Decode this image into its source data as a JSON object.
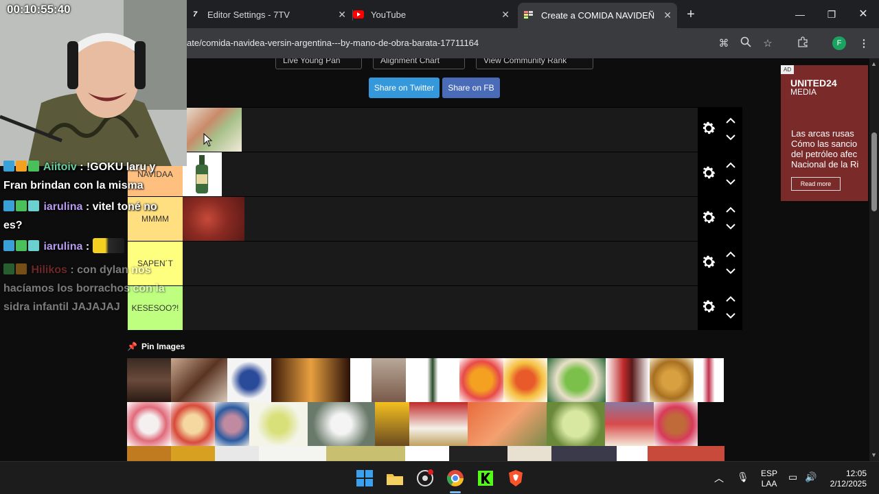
{
  "browser": {
    "tabs": [
      {
        "title": "Editor Settings - 7TV",
        "icon": "7tv-icon"
      },
      {
        "title": "YouTube",
        "icon": "youtube-icon"
      },
      {
        "title": "Create a COMIDA NAVIDEÑA ve",
        "icon": "tiermaker-icon"
      }
    ],
    "url": "ate/comida-navidea-versin-argentina---by-mano-de-obra-barata-17711164",
    "profile_initial": "F"
  },
  "page": {
    "top_buttons": [
      "Live Young Pan",
      "Alignment Chart",
      "View Community Rank"
    ],
    "share_twitter": "Share on Twitter",
    "share_fb": "Share on FB",
    "tiers": [
      {
        "label": "",
        "color": "#ff7f7f"
      },
      {
        "label": "NAVIDAA",
        "color": "#ffbf7f"
      },
      {
        "label": "MMMM",
        "color": "#ffdf7f"
      },
      {
        "label": "SAPEN´T",
        "color": "#ffff7f"
      },
      {
        "label": "KESESOO?!",
        "color": "#bfff7f"
      }
    ],
    "pin_images_label": "Pin Images"
  },
  "ad": {
    "tag": "AD",
    "brand_line1": "UNITED24",
    "brand_line2": "MEDIA",
    "text_lines": [
      "Las arcas rusas",
      "Cómo las sancio",
      "del petróleo afec",
      "Nacional de la Ri"
    ],
    "button": "Read more"
  },
  "stream": {
    "timer": "00:10:55:40",
    "chat": [
      {
        "user": "Aiitoiv",
        "text": ": !GOKU laru y Fran brindan con la misma"
      },
      {
        "user": "iarulina",
        "text": ": vitel toné no es?"
      },
      {
        "user": "iarulina",
        "text": ":"
      },
      {
        "user": "Hilikos",
        "text": ": con dylan nos hacíamos los borrachos con la sidra infantil JAJAJAJ"
      }
    ]
  },
  "taskbar": {
    "lang": "ESP",
    "lang_sub": "LAA",
    "time": "12:05",
    "date": "2/12/2025"
  }
}
